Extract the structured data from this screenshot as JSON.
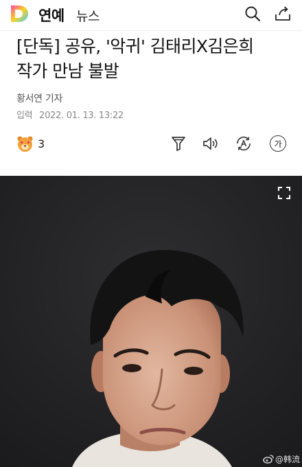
{
  "header": {
    "logo_letter": "D",
    "section": "연예",
    "subsection": "뉴스",
    "icons": [
      "search-icon",
      "share-icon"
    ]
  },
  "article": {
    "title_line1": "[단독] 공유, '악귀' 김태리X김은희",
    "title_line2": "작가 만남 불발",
    "author": "황서연 기자",
    "date_label": "입력",
    "date": "2022. 01. 13. 13:22"
  },
  "actions": {
    "reaction_count": "3",
    "font_button_label": "가",
    "icons": [
      "reaction-face-icon",
      "summary-filter-icon",
      "text-to-speech-icon",
      "translate-icon",
      "font-size-icon"
    ]
  },
  "photo": {
    "expand_icon": "expand-icon",
    "watermark_text": "@韩流"
  },
  "colors": {
    "logo_gradient": [
      "#ff4aa5",
      "#f9d423",
      "#3ec9ff"
    ],
    "text_primary": "#111111",
    "text_meta": "#888888",
    "photo_background": "#222225"
  }
}
